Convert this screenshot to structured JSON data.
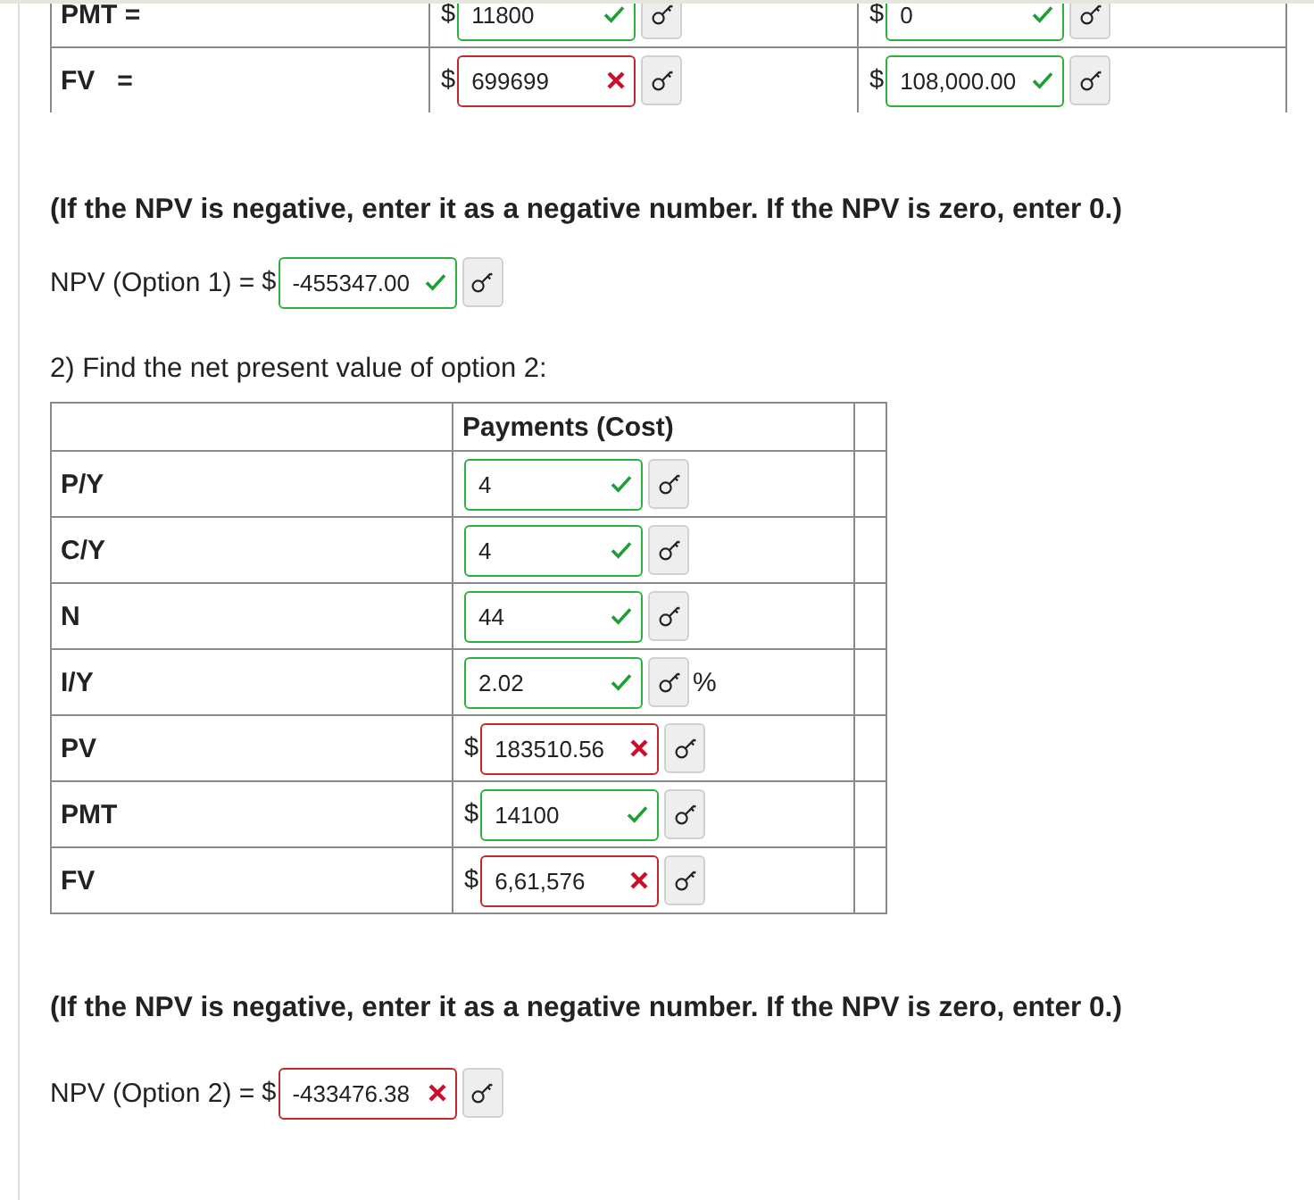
{
  "table_1": {
    "rows": [
      {
        "label": "PMT =",
        "cells": [
          {
            "prefix": "$",
            "value": "11800",
            "correct": true
          },
          {
            "prefix": "$",
            "value": "0",
            "correct": true
          }
        ]
      },
      {
        "label": "FV   =",
        "cells": [
          {
            "prefix": "$",
            "value": "699699",
            "correct": false
          },
          {
            "prefix": "$",
            "value": "108,000.00",
            "correct": true
          }
        ]
      }
    ]
  },
  "note_1": "(If the NPV is negative, enter it as a negative number. If the NPV is zero, enter 0.)",
  "npv_1": {
    "label": "NPV (Option 1) =",
    "prefix": "$",
    "value": "-455347.00",
    "correct": true
  },
  "question_2": "2) Find the net present value of option 2:",
  "table_2": {
    "columns": [
      "Payments (Cost)"
    ],
    "rows": [
      {
        "label": "P/Y",
        "cells": [
          {
            "value": "4",
            "correct": true
          }
        ]
      },
      {
        "label": "C/Y",
        "cells": [
          {
            "value": "4",
            "correct": true
          }
        ]
      },
      {
        "label": "N",
        "cells": [
          {
            "value": "44",
            "correct": true
          }
        ]
      },
      {
        "label": "I/Y",
        "cells": [
          {
            "value": "2.02",
            "correct": true,
            "suffix": "%"
          }
        ]
      },
      {
        "label": "PV",
        "cells": [
          {
            "prefix": "$",
            "value": "183510.56",
            "correct": false
          }
        ]
      },
      {
        "label": "PMT",
        "cells": [
          {
            "prefix": "$",
            "value": "14100",
            "correct": true
          }
        ]
      },
      {
        "label": "FV",
        "cells": [
          {
            "prefix": "$",
            "value": "6,61,576",
            "correct": false
          }
        ]
      }
    ]
  },
  "note_2": "(If the NPV is negative, enter it as a negative number. If the NPV is zero, enter 0.)",
  "npv_2": {
    "label": "NPV (Option 2) =",
    "prefix": "$",
    "value": "-433476.38",
    "correct": false
  }
}
